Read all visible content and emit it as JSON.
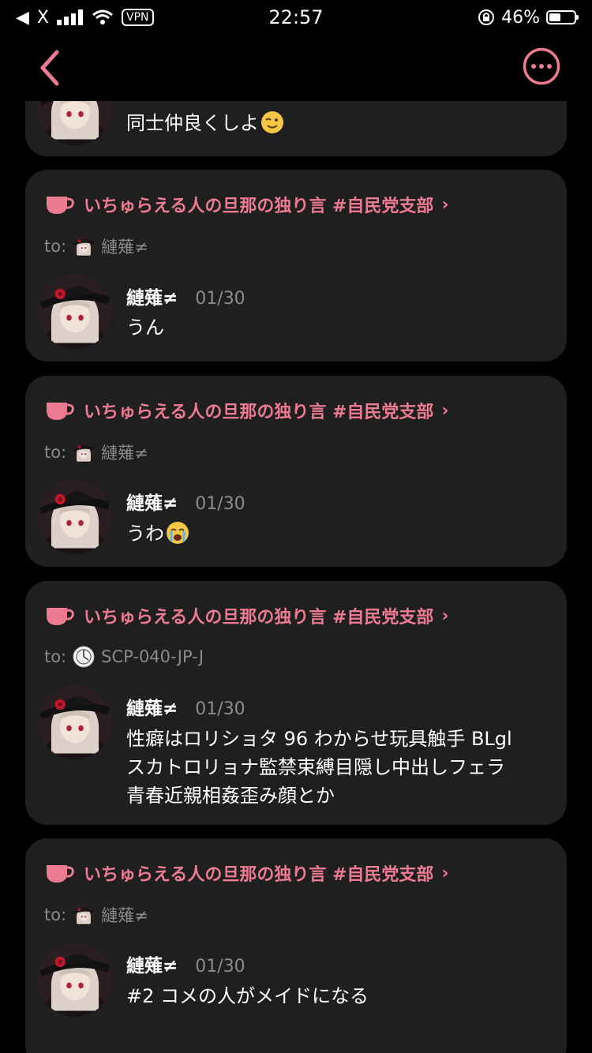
{
  "status_bar": {
    "carrier": "X",
    "vpn": "VPN",
    "time": "22:57",
    "battery": "46%",
    "battery_level": 0.46
  },
  "nav": {
    "back_icon": "chevron-left-icon",
    "more_icon": "more-horizontal-icon"
  },
  "colors": {
    "accent": "#ec7b92",
    "card": "#1f1f1f",
    "muted": "#8a8a8a"
  },
  "partial_post": {
    "message": "同士仲良くしよ",
    "emoji": "wink-emoji"
  },
  "posts": [
    {
      "group": "いちゅらえる人の旦那の独り言 #自民党支部",
      "to_label": "to:",
      "to_name": "縺薙≠",
      "author": "縺薙≠",
      "date": "01/30",
      "message_lines": [
        "うん"
      ]
    },
    {
      "group": "いちゅらえる人の旦那の独り言 #自民党支部",
      "to_label": "to:",
      "to_name": "縺薙≠",
      "author": "縺薙≠",
      "date": "01/30",
      "message_lines": [
        "うわ"
      ],
      "emoji": "crying-emoji"
    },
    {
      "group": "いちゅらえる人の旦那の独り言 #自民党支部",
      "to_label": "to:",
      "to_name": "SCP-040-JP-J",
      "author": "縺薙≠",
      "date": "01/30",
      "message_lines": [
        "性癖はロリショタ 96 わからせ玩具触手 BLgl",
        "スカトロリョナ監禁束縛目隠し中出しフェラ",
        "青春近親相姦歪み顔とか"
      ]
    },
    {
      "group": "いちゅらえる人の旦那の独り言 #自民党支部",
      "to_label": "to:",
      "to_name": "縺薙≠",
      "author": "縺薙≠",
      "date": "01/30",
      "message_lines": [
        "#2 コメの人がメイドになる"
      ]
    }
  ]
}
